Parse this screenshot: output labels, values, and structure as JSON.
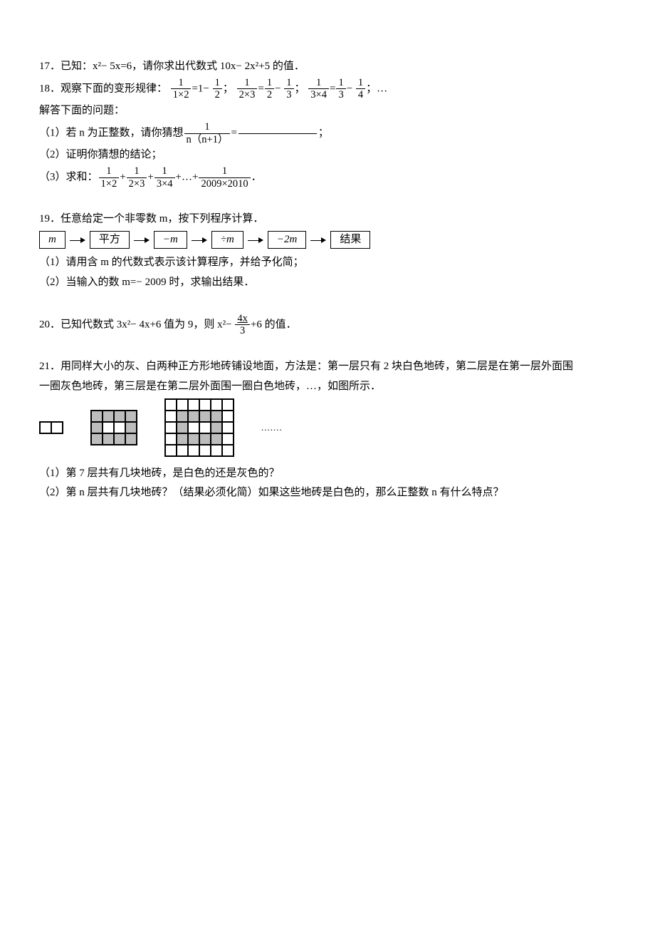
{
  "q17": {
    "num": "17",
    "text": "已知：x²− 5x=6，请你求出代数式 10x− 2x²+5 的值．"
  },
  "q18": {
    "num": "18",
    "lead": "观察下面的变形规律：",
    "f1_num": "1",
    "f1_den": "1×2",
    "eq1": "=1−",
    "f2_num": "1",
    "f2_den": "2",
    "sep": "；",
    "f3_num": "1",
    "f3_den": "2×3",
    "eq2": "=",
    "f4_num": "1",
    "f4_den": "2",
    "minus": "−",
    "f5_num": "1",
    "f5_den": "3",
    "f6_num": "1",
    "f6_den": "3×4",
    "f7_num": "1",
    "f7_den": "3",
    "f8_num": "1",
    "f8_den": "4",
    "tail": "；…",
    "line2": "解答下面的问题：",
    "p1_a": "（1）若 n 为正整数，请你猜想",
    "p1_frac_num": "1",
    "p1_frac_den": "n（n+1）",
    "p1_b": "=",
    "p1_c": "；",
    "p2": "（2）证明你猜想的结论；",
    "p3_a": "（3）求和：",
    "s1_num": "1",
    "s1_den": "1×2",
    "plus": "+",
    "s2_num": "1",
    "s2_den": "2×3",
    "s3_num": "1",
    "s3_den": "3×4",
    "dots": "+…+",
    "s4_num": "1",
    "s4_den": "2009×2010",
    "period": "．"
  },
  "q19": {
    "num": "19",
    "text": "任意给定一个非零数 m，按下列程序计算．",
    "boxes": [
      "m",
      "平方",
      "−m",
      "÷m",
      "−2m",
      "结果"
    ],
    "p1": "（1）请用含 m 的代数式表示该计算程序，并给予化简；",
    "p2": "（2）当输入的数 m=− 2009 时，求输出结果．"
  },
  "q20": {
    "num": "20",
    "a": "已知代数式 3x²− 4x+6 值为 9，则 x²−",
    "frac_num": "4x",
    "frac_den": "3",
    "b": "+6 的值．"
  },
  "q21": {
    "num": "21",
    "l1": "用同样大小的灰、白两种正方形地砖铺设地面，方法是：第一层只有 2 块白色地砖，第二层是在第一层外面围",
    "l2": "一圈灰色地砖，第三层是在第二层外面围一圈白色地砖，…，如图所示．",
    "dots": ".......",
    "p1": "（1）第 7 层共有几块地砖，是白色的还是灰色的？",
    "p2": "（2）第 n 层共有几块地砖？（结果必须化简）如果这些地砖是白色的，那么正整数 n 有什么特点？"
  }
}
